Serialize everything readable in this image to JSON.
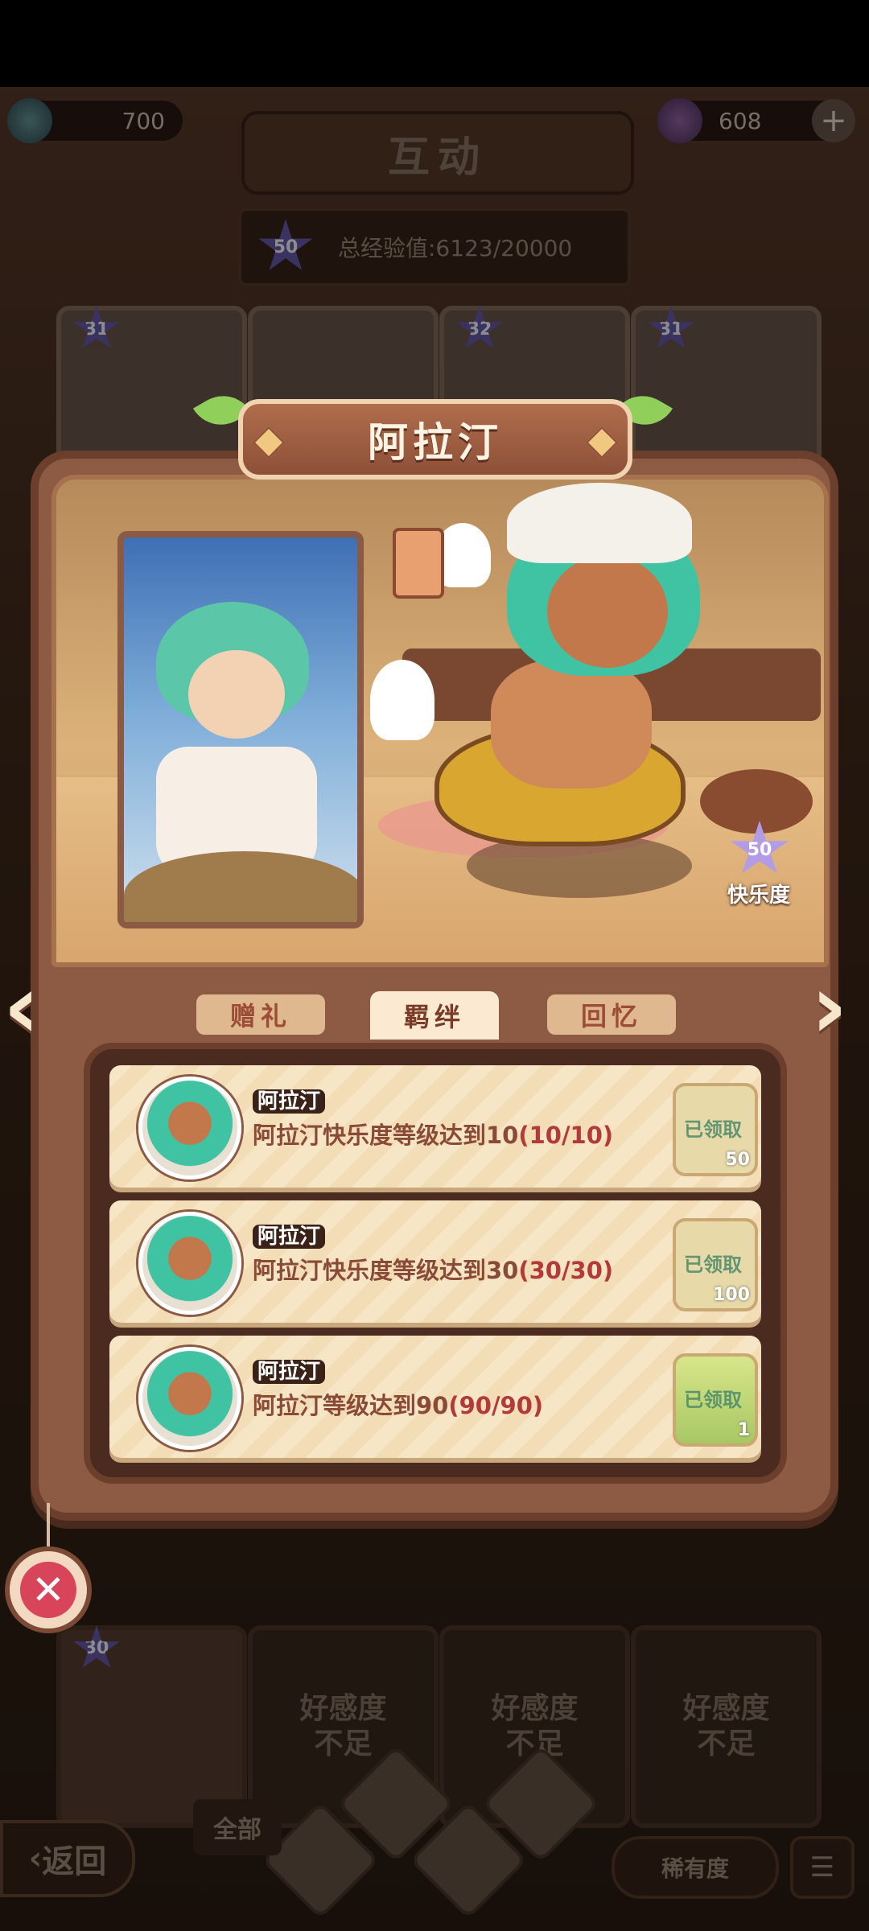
{
  "resources": {
    "left_value": "700",
    "right_value": "608"
  },
  "header": {
    "title": "互动",
    "exp_level": "50",
    "total_exp": "总经验值:6123/20000"
  },
  "background_cards": {
    "levels": [
      "31",
      "32",
      "31"
    ],
    "bottom_level": "30",
    "locked_text": [
      "好感度\n不足",
      "好感度\n不足",
      "好感度\n不足"
    ]
  },
  "panel": {
    "character_name": "阿拉汀",
    "happiness_level": "50",
    "happiness_label": "快乐度",
    "tabs": [
      {
        "label": "赠礼",
        "active": false
      },
      {
        "label": "羁绊",
        "active": true
      },
      {
        "label": "回忆",
        "active": false
      }
    ],
    "bonds": [
      {
        "name": "阿拉汀",
        "text": "阿拉汀快乐度等级达到10",
        "progress": "(10/10)",
        "status": "已领取",
        "count": "50"
      },
      {
        "name": "阿拉汀",
        "text": "阿拉汀快乐度等级达到30",
        "progress": "(30/30)",
        "status": "已领取",
        "count": "100"
      },
      {
        "name": "阿拉汀",
        "text": "阿拉汀等级达到90",
        "progress": "(90/90)",
        "status": "已领取",
        "count": "1"
      }
    ]
  },
  "bottom_nav": {
    "back": "返回",
    "all": "全部",
    "rarity": "稀有度"
  },
  "colors": {
    "panel": "#8d5a43",
    "frame": "#6b3f2c",
    "active_tab": "#fbe9d2",
    "progress_text": "#b23a3a"
  }
}
